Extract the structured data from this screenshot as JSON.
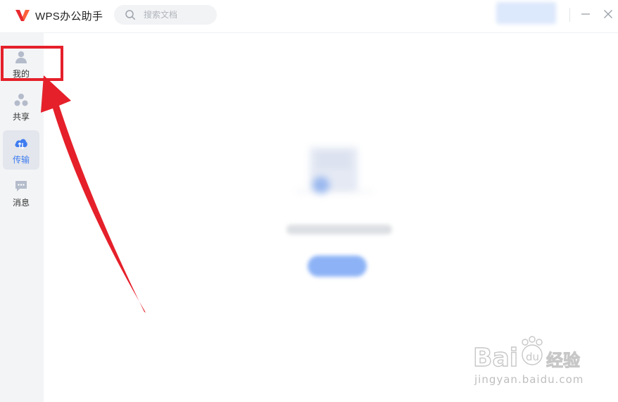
{
  "app": {
    "title": "WPS办公助手",
    "brand_color": "#e8292f",
    "accent_color": "#3f7cf0"
  },
  "search": {
    "placeholder": "搜索文档",
    "icon": "search-icon"
  },
  "window_controls": [
    {
      "name": "minimize",
      "icon": "minimize-icon"
    },
    {
      "name": "close",
      "icon": "close-icon"
    }
  ],
  "sidebar": {
    "items": [
      {
        "label": "我的",
        "icon": "user-icon",
        "active": false
      },
      {
        "label": "共享",
        "icon": "share-icon",
        "active": false
      },
      {
        "label": "传输",
        "icon": "cloud-transfer-icon",
        "active": true
      },
      {
        "label": "消息",
        "icon": "message-icon",
        "active": false
      }
    ]
  },
  "annotation": {
    "color": "#e5202a",
    "target": "sidebar-item-me"
  },
  "watermark": {
    "brand": "Bai du 经验",
    "url": "jingyan.baidu.com"
  }
}
